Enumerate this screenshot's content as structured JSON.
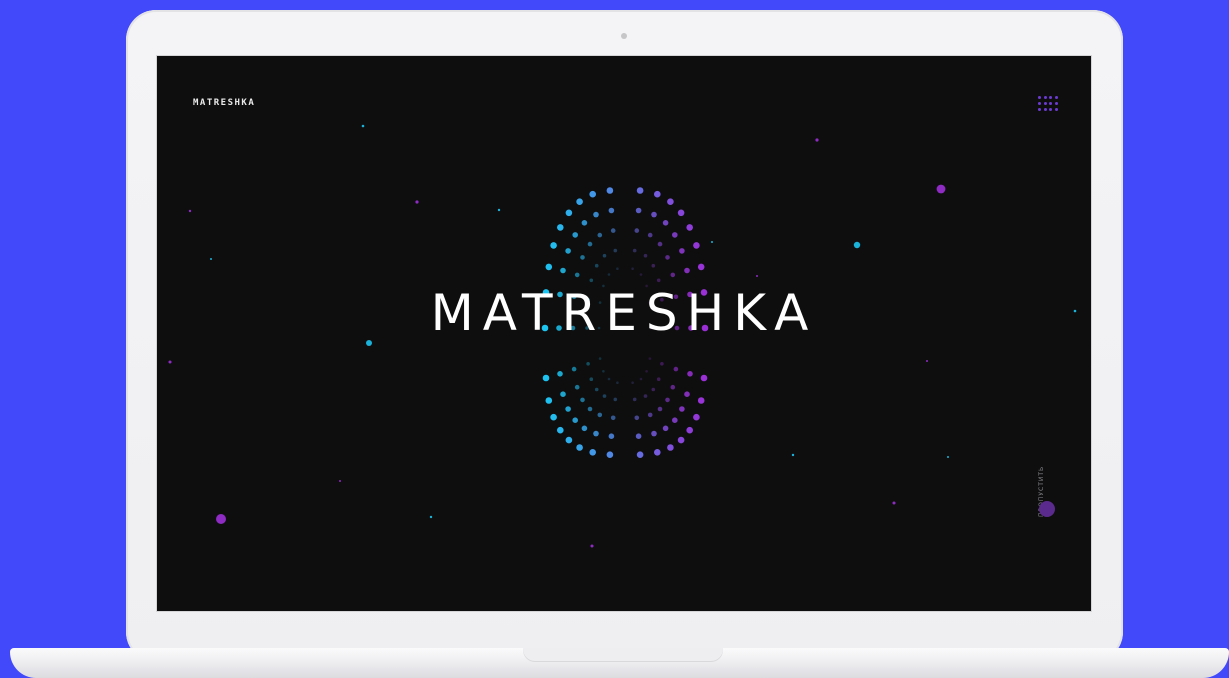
{
  "header": {
    "logo_text": "MATRESHKA",
    "menu_icon": "grid-dots-icon"
  },
  "hero": {
    "title": "MATRESHKA"
  },
  "skip": {
    "label": "ПРОПУСТИТЬ"
  },
  "colors": {
    "page_background": "#4149fb",
    "screen_background": "#0e0e0f",
    "accent_cyan": "#1cc4f0",
    "accent_purple": "#9b2fd6",
    "accent_violet": "#6c3bd3",
    "text": "#ffffff"
  }
}
